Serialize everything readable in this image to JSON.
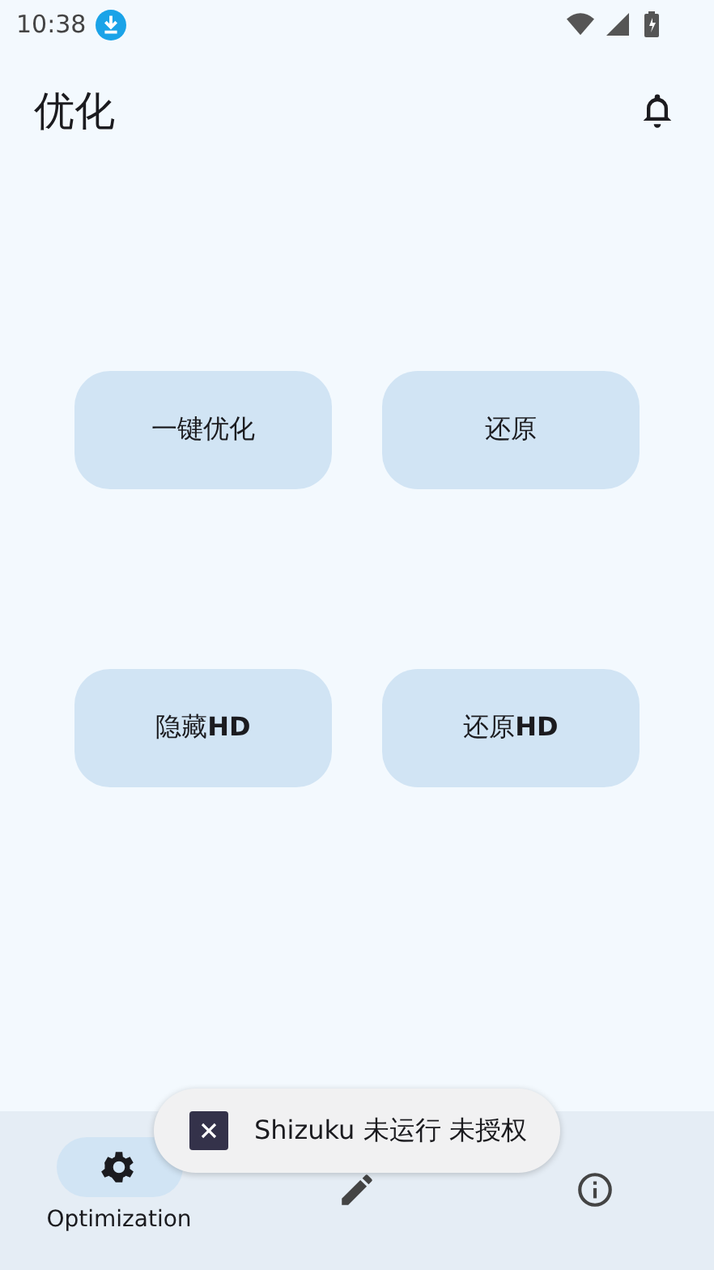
{
  "status_bar": {
    "time": "10:38"
  },
  "app_bar": {
    "title": "优化"
  },
  "actions": [
    {
      "label": "一键优化"
    },
    {
      "label": "还原"
    },
    {
      "label": "隐藏**HD**"
    },
    {
      "label": "还原**HD**"
    }
  ],
  "bottom_nav": [
    {
      "label": "Optimization",
      "selected": true
    },
    {
      "selected": false
    },
    {
      "selected": false
    }
  ],
  "toast": {
    "text": "Shizuku 未运行 未授权"
  }
}
